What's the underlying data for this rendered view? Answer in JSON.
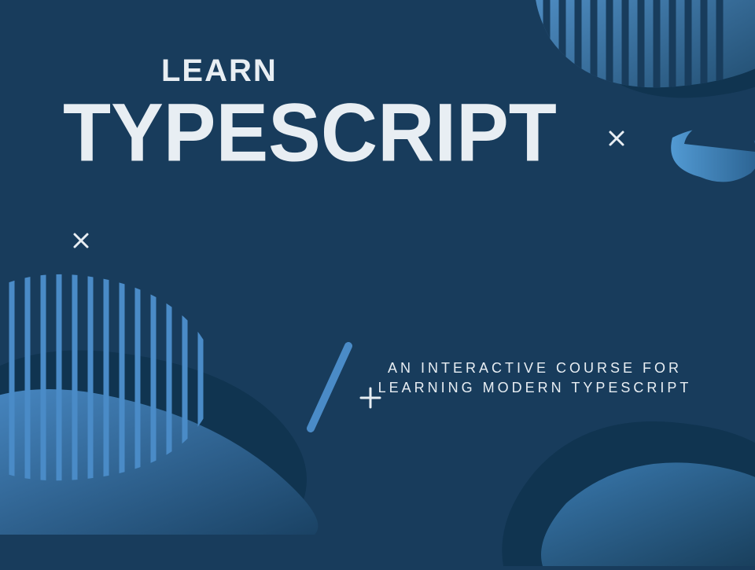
{
  "heading": {
    "small": "LEARN",
    "large": "TYPESCRIPT"
  },
  "subtitle": {
    "line1": "AN INTERACTIVE COURSE FOR",
    "line2": "LEARNING MODERN TYPESCRIPT"
  },
  "colors": {
    "background": "#183c5c",
    "accent_light": "#4a8bc7",
    "accent_dark": "#103450",
    "text": "#e8eef3"
  }
}
